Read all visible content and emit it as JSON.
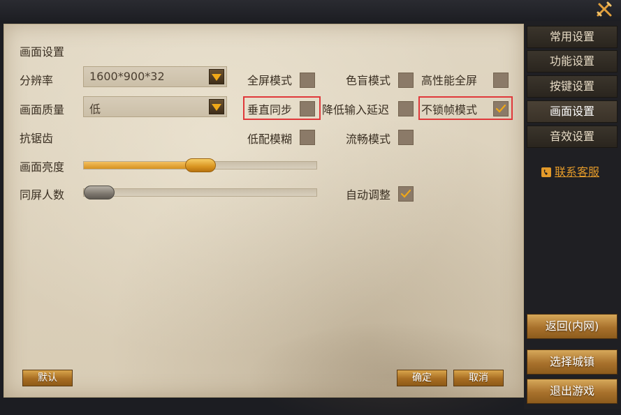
{
  "panel": {
    "section_title": "画面设置",
    "rows": {
      "resolution_label": "分辨率",
      "quality_label": "画面质量",
      "antialias_label": "抗锯齿",
      "brightness_label": "画面亮度",
      "players_label": "同屏人数"
    },
    "resolution": {
      "value": "1600*900*32"
    },
    "quality": {
      "value": "低"
    },
    "options": {
      "fullscreen": {
        "label": "全屏模式",
        "checked": false
      },
      "colorblind": {
        "label": "色盲模式",
        "checked": false
      },
      "high_perf_fullscreen": {
        "label": "高性能全屏",
        "checked": false
      },
      "vsync": {
        "label": "垂直同步",
        "checked": false,
        "highlighted": true
      },
      "low_input_latency": {
        "label": "降低输入延迟",
        "checked": false
      },
      "unlocked_fps": {
        "label": "不锁帧模式",
        "checked": true,
        "highlighted": true
      },
      "low_blur": {
        "label": "低配模糊",
        "checked": false
      },
      "smooth_mode": {
        "label": "流畅模式",
        "checked": false
      },
      "auto_adjust": {
        "label": "自动调整",
        "checked": true
      }
    },
    "brightness_level": 0.5,
    "players_level": 0.0,
    "buttons": {
      "default_label": "默认",
      "confirm_label": "确定",
      "cancel_label": "取消"
    }
  },
  "sidebar": {
    "tabs": [
      {
        "label": "常用设置",
        "active": false
      },
      {
        "label": "功能设置",
        "active": false
      },
      {
        "label": "按键设置",
        "active": false
      },
      {
        "label": "画面设置",
        "active": true
      },
      {
        "label": "音效设置",
        "active": false
      }
    ],
    "service_label": "联系客服",
    "service_icon": "phone-icon",
    "back_label": "返回(内网)",
    "select_town_label": "选择城镇",
    "exit_label": "退出游戏"
  },
  "icons": {
    "close": "close-icon",
    "checkmark": "checkmark-icon",
    "dropdown_arrow": "chevron-down-icon"
  },
  "colors": {
    "accent_gold": "#e39a2a",
    "highlight_red": "#e0383a",
    "panel_bg": "#ddd2bd"
  }
}
